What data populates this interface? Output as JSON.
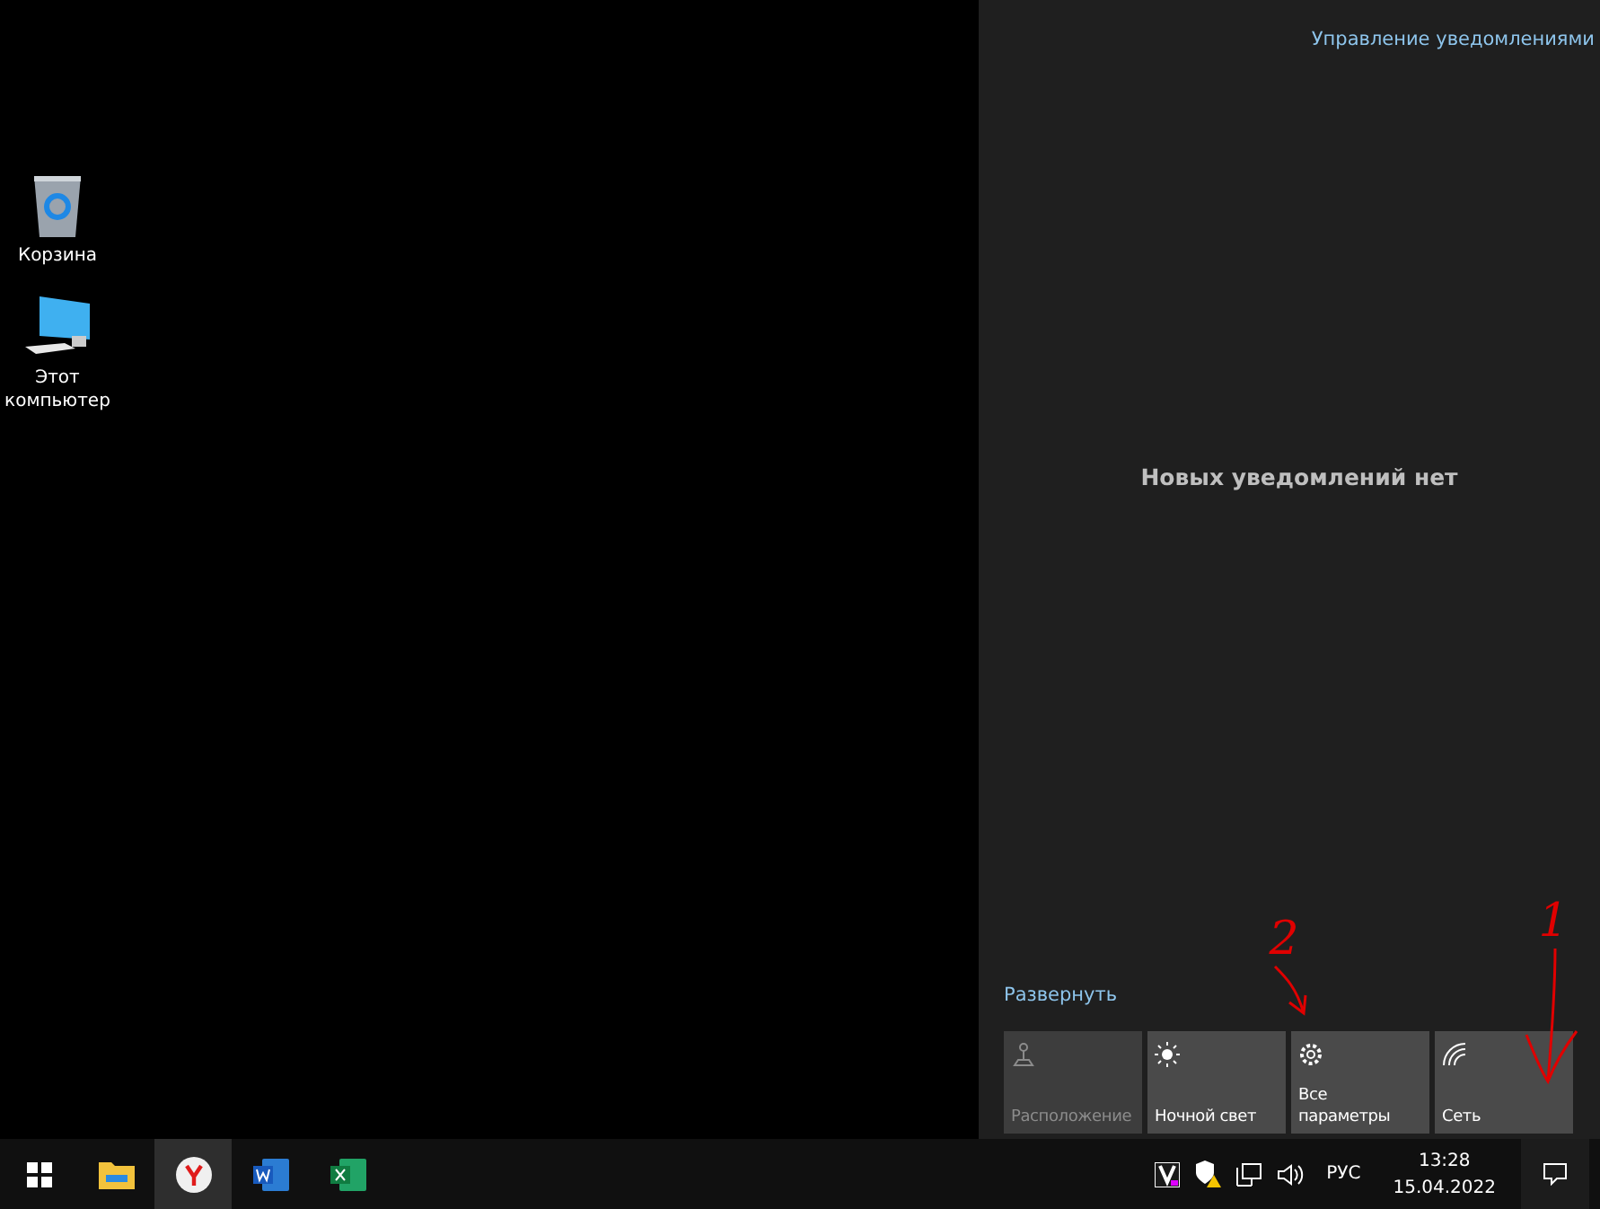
{
  "desktop": {
    "icons": [
      {
        "kind": "recycle-bin",
        "label": "Корзина"
      },
      {
        "kind": "computer",
        "label": "Этот компьютер"
      }
    ]
  },
  "action_center": {
    "manage_link": "Управление уведомлениями",
    "empty_message": "Новых уведомлений нет",
    "expand_link": "Развернуть",
    "tiles": [
      {
        "kind": "location",
        "label": "Расположение",
        "disabled": true
      },
      {
        "kind": "night-light",
        "label": "Ночной свет",
        "disabled": false
      },
      {
        "kind": "settings",
        "label": "Все параметры",
        "disabled": false
      },
      {
        "kind": "network",
        "label": "Сеть",
        "disabled": false
      }
    ]
  },
  "annotations": [
    {
      "label": "2"
    },
    {
      "label": "1"
    }
  ],
  "taskbar": {
    "apps": [
      {
        "kind": "start",
        "selected": false
      },
      {
        "kind": "explorer",
        "selected": false
      },
      {
        "kind": "browser",
        "selected": true
      },
      {
        "kind": "word",
        "selected": false
      },
      {
        "kind": "excel",
        "selected": false
      }
    ],
    "tray": {
      "language": "РУС",
      "time": "13:28",
      "date": "15.04.2022"
    }
  }
}
